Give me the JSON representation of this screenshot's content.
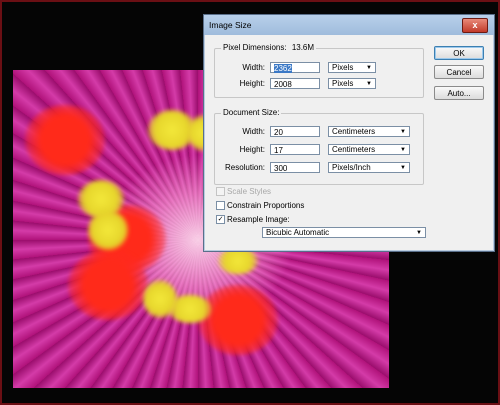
{
  "dialog": {
    "title": "Image Size",
    "close_glyph": "x",
    "pixel_dimensions": {
      "label": "Pixel Dimensions:",
      "size": "13.6M",
      "width_label": "Width:",
      "width_value": "2362",
      "width_unit": "Pixels",
      "height_label": "Height:",
      "height_value": "2008",
      "height_unit": "Pixels"
    },
    "document_size": {
      "label": "Document Size:",
      "width_label": "Width:",
      "width_value": "20",
      "width_unit": "Centimeters",
      "height_label": "Height:",
      "height_value": "17",
      "height_unit": "Centimeters",
      "resolution_label": "Resolution:",
      "resolution_value": "300",
      "resolution_unit": "Pixels/Inch"
    },
    "options": {
      "scale_styles": {
        "label": "Scale Styles",
        "checked": false,
        "enabled": false
      },
      "constrain_proportions": {
        "label": "Constrain Proportions",
        "checked": false
      },
      "resample_image": {
        "label": "Resample Image:",
        "checked": true,
        "check_glyph": "✓"
      },
      "resample_method": "Bicubic Automatic"
    },
    "buttons": {
      "ok": "OK",
      "cancel": "Cancel",
      "auto": "Auto..."
    }
  },
  "dropdown_arrow_glyph": "▼",
  "colors": {
    "titlebar": "#a9c4e2",
    "selection": "#3a78c6",
    "flower_magenta": "#b0127a",
    "flower_red": "#ff2a1a",
    "flower_yellow": "#e6d52b"
  }
}
